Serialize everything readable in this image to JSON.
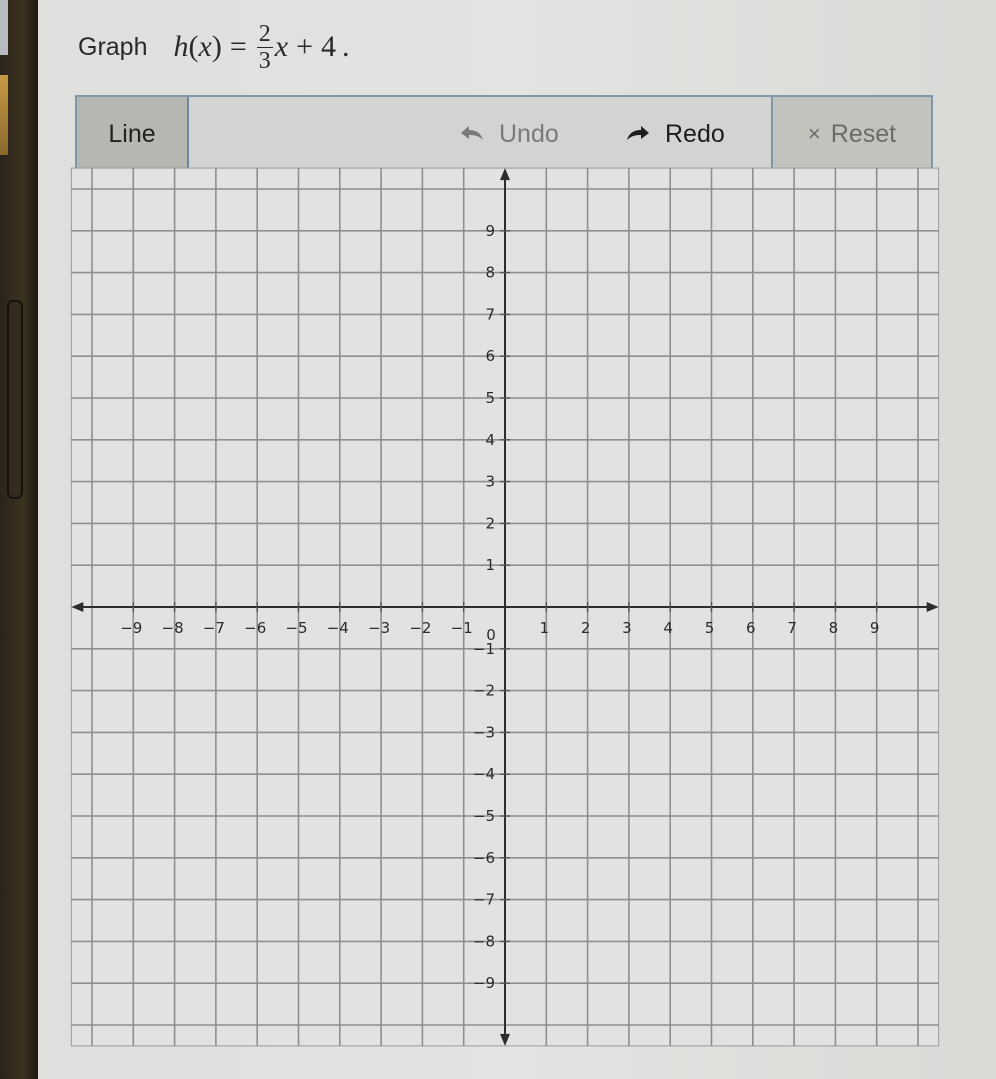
{
  "prompt": {
    "label": "Graph",
    "function_name": "h",
    "variable": "x",
    "equals": "=",
    "slope_numerator": "2",
    "slope_denominator": "3",
    "plus": "+",
    "intercept": "4",
    "period": "."
  },
  "toolbar": {
    "line_label": "Line",
    "undo_label": "Undo",
    "redo_label": "Redo",
    "reset_label": "Reset",
    "undo_icon": "undo-arrow-icon",
    "redo_icon": "redo-arrow-icon",
    "reset_icon": "close-x-icon",
    "reset_glyph": "×"
  },
  "chart_data": {
    "type": "scatter",
    "title": "",
    "xlabel": "",
    "ylabel": "",
    "xlim": [
      -10.5,
      10.5
    ],
    "ylim": [
      -10.5,
      10.5
    ],
    "grid": true,
    "x_ticks": [
      -9,
      -8,
      -7,
      -6,
      -5,
      -4,
      -3,
      -2,
      -1,
      1,
      2,
      3,
      4,
      5,
      6,
      7,
      8,
      9
    ],
    "y_ticks": [
      -9,
      -8,
      -7,
      -6,
      -5,
      -4,
      -3,
      -2,
      -1,
      1,
      2,
      3,
      4,
      5,
      6,
      7,
      8,
      9
    ],
    "x_tick_labels": [
      "−9",
      "−8",
      "−7",
      "−6",
      "−5",
      "−4",
      "−3",
      "−2",
      "−1",
      "1",
      "2",
      "3",
      "4",
      "5",
      "6",
      "7",
      "8",
      "9"
    ],
    "y_tick_labels": [
      "−9",
      "−8",
      "−7",
      "−6",
      "−5",
      "−4",
      "−3",
      "−2",
      "−1",
      "1",
      "2",
      "3",
      "4",
      "5",
      "6",
      "7",
      "8",
      "9"
    ],
    "origin_label": "0",
    "series": [],
    "legend": "none"
  }
}
